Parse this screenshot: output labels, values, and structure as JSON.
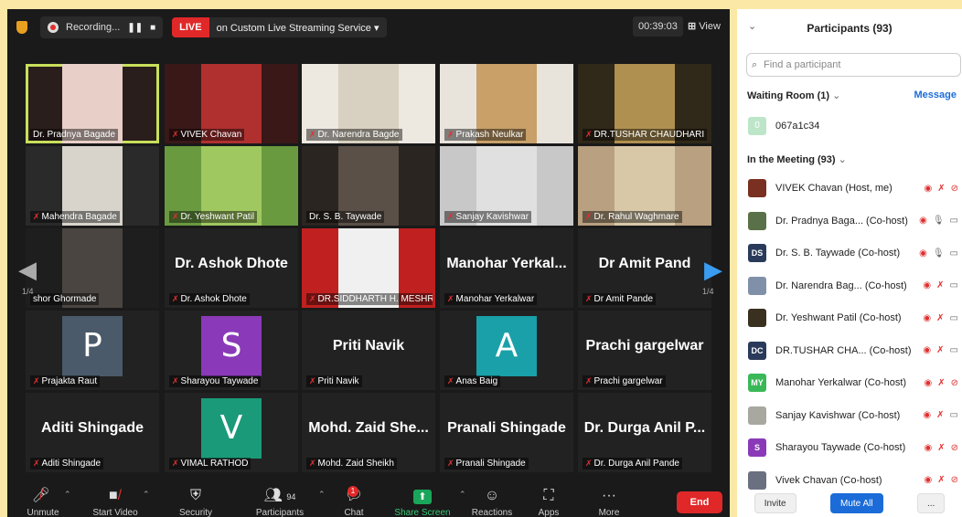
{
  "topbar": {
    "recording": "Recording...",
    "live": "LIVE",
    "stream": "on Custom Live Streaming Service ▾",
    "timer": "00:39:03",
    "view": "View"
  },
  "tiles": [
    {
      "name": "Dr. Pradnya Bagade",
      "muted": false,
      "active": true,
      "kind": "video",
      "bg": "#2a1e1c",
      "fg": "#e8d0c8"
    },
    {
      "name": "VIVEK Chavan",
      "muted": true,
      "kind": "video",
      "bg": "#3a1818",
      "fg": "#b03030"
    },
    {
      "name": "Dr. Narendra Bagde",
      "muted": true,
      "kind": "video",
      "bg": "#ede8e0",
      "fg": "#d8d0c0"
    },
    {
      "name": "Prakash Neulkar",
      "muted": true,
      "kind": "video",
      "bg": "#e8e4dc",
      "fg": "#c8a068"
    },
    {
      "name": "DR.TUSHAR CHAUDHARI",
      "muted": true,
      "kind": "video",
      "bg": "#302818",
      "fg": "#b09050"
    },
    {
      "name": "Mahendra Bagade",
      "muted": true,
      "kind": "video",
      "bg": "#2a2a2a",
      "fg": "#d8d4cc"
    },
    {
      "name": "Dr. Yeshwant Patil",
      "muted": true,
      "kind": "video",
      "bg": "#6a9a40",
      "fg": "#a0c860"
    },
    {
      "name": "Dr. S. B. Taywade",
      "muted": false,
      "kind": "video",
      "bg": "#2a2520",
      "fg": "#5a5048"
    },
    {
      "name": "Sanjay Kavishwar",
      "muted": true,
      "kind": "video",
      "bg": "#c8c8c8",
      "fg": "#e0e0e0"
    },
    {
      "name": "Dr. Rahul Waghmare",
      "muted": true,
      "kind": "video",
      "bg": "#b8a080",
      "fg": "#d8c8a8"
    },
    {
      "name": "shor Ghormade",
      "muted": false,
      "kind": "video",
      "bg": "#1e1e1e",
      "fg": "#4a4540"
    },
    {
      "name": "Dr. Ashok Dhote",
      "muted": true,
      "kind": "name",
      "big": "Dr. Ashok Dhote"
    },
    {
      "name": "DR.SIDDHARTH H. MESHR...",
      "muted": true,
      "kind": "video",
      "bg": "#c02020",
      "fg": "#f0f0f0"
    },
    {
      "name": "Manohar Yerkalwar",
      "muted": true,
      "kind": "name",
      "big": "Manohar  Yerkal..."
    },
    {
      "name": "Dr Amit Pande",
      "muted": true,
      "kind": "name",
      "big": "Dr Amit Pand"
    },
    {
      "name": "Prajakta Raut",
      "muted": true,
      "kind": "avatar",
      "letter": "P",
      "color": "#4a5a6a"
    },
    {
      "name": "Sharayou Taywade",
      "muted": true,
      "kind": "avatar",
      "letter": "S",
      "color": "#8a3ab8"
    },
    {
      "name": "Priti Navik",
      "muted": true,
      "kind": "name",
      "big": "Priti Navik"
    },
    {
      "name": "Anas Baig",
      "muted": true,
      "kind": "avatar",
      "letter": "A",
      "color": "#1aa0a8"
    },
    {
      "name": "Prachi gargelwar",
      "muted": true,
      "kind": "name",
      "big": "Prachi gargelwar"
    },
    {
      "name": "Aditi Shingade",
      "muted": true,
      "kind": "name",
      "big": "Aditi Shingade"
    },
    {
      "name": "VIMAL RATHOD",
      "muted": true,
      "kind": "avatar",
      "letter": "V",
      "color": "#1a9a78"
    },
    {
      "name": "Mohd. Zaid Sheikh",
      "muted": true,
      "kind": "name",
      "big": "Mohd. Zaid She..."
    },
    {
      "name": "Pranali Shingade",
      "muted": true,
      "kind": "name",
      "big": "Pranali Shingade"
    },
    {
      "name": "Dr. Durga Anil Pande",
      "muted": true,
      "kind": "name",
      "big": "Dr. Durga Anil P..."
    }
  ],
  "pages": {
    "left": "1/4",
    "right": "1/4"
  },
  "toolbar": {
    "unmute": "Unmute",
    "start_video": "Start Video",
    "security": "Security",
    "participants": "Participants",
    "participants_count": "94",
    "chat": "Chat",
    "chat_badge": "1",
    "share": "Share Screen",
    "reactions": "Reactions",
    "apps": "Apps",
    "more": "More",
    "end": "End"
  },
  "panel": {
    "title": "Participants (93)",
    "search_placeholder": "Find a participant",
    "waiting_title": "Waiting Room (1)",
    "message": "Message",
    "waiting_user": "067a1c34",
    "waiting_initial": "0",
    "meeting_title": "In the Meeting (93)",
    "people": [
      {
        "name": "VIVEK Chavan (Host, me)",
        "initials": "",
        "color": "#7a3020",
        "mic": "muted",
        "cam": "off"
      },
      {
        "name": "Dr. Pradnya Baga... (Co-host)",
        "initials": "",
        "color": "#5a7048",
        "mic": "on",
        "cam": "on"
      },
      {
        "name": "Dr. S. B. Taywade (Co-host)",
        "initials": "DS",
        "color": "#2a3a5a",
        "mic": "on",
        "cam": "on"
      },
      {
        "name": "Dr. Narendra Bag... (Co-host)",
        "initials": "",
        "color": "#8090a8",
        "mic": "muted",
        "cam": "on"
      },
      {
        "name": "Dr. Yeshwant Patil (Co-host)",
        "initials": "",
        "color": "#3a3020",
        "mic": "muted",
        "cam": "on"
      },
      {
        "name": "DR.TUSHAR CHA... (Co-host)",
        "initials": "DC",
        "color": "#2a3a5a",
        "mic": "muted",
        "cam": "on"
      },
      {
        "name": "Manohar Yerkalwar (Co-host)",
        "initials": "MY",
        "color": "#3ab858",
        "mic": "muted",
        "cam": "off"
      },
      {
        "name": "Sanjay Kavishwar (Co-host)",
        "initials": "",
        "color": "#a8a8a0",
        "mic": "muted",
        "cam": "on"
      },
      {
        "name": "Sharayou Taywade (Co-host)",
        "initials": "S",
        "color": "#8a3ab8",
        "mic": "muted",
        "cam": "off"
      },
      {
        "name": "Vivek Chavan (Co-host)",
        "initials": "",
        "color": "#6a7080",
        "mic": "muted",
        "cam": "off"
      }
    ],
    "invite": "Invite",
    "mute_all": "Mute All",
    "more": "..."
  }
}
